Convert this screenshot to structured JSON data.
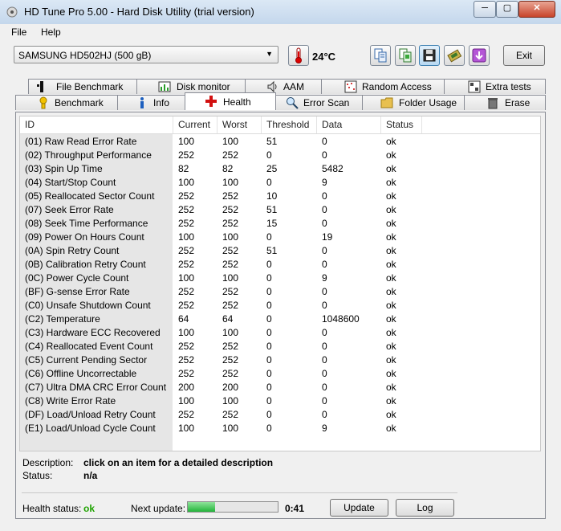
{
  "window": {
    "title": "HD Tune Pro 5.00 - Hard Disk Utility (trial version)",
    "minimize_glyph": "─",
    "maximize_glyph": "▢",
    "close_glyph": "✕"
  },
  "menu": {
    "file": "File",
    "help": "Help"
  },
  "toolbar": {
    "disk": "SAMSUNG HD502HJ (500 gB)",
    "temperature": "24°C",
    "exit_label": "Exit",
    "buttons": [
      "copy-info-icon",
      "copy-screenshot-icon",
      "save-icon",
      "options-icon",
      "download-icon"
    ]
  },
  "tabs": {
    "top": [
      "File Benchmark",
      "Disk monitor",
      "AAM",
      "Random Access",
      "Extra tests"
    ],
    "bottom": [
      "Benchmark",
      "Info",
      "Health",
      "Error Scan",
      "Folder Usage",
      "Erase"
    ],
    "active": "Health"
  },
  "table": {
    "columns": [
      "ID",
      "Current",
      "Worst",
      "Threshold",
      "Data",
      "Status"
    ],
    "rows": [
      [
        "(01) Raw Read Error Rate",
        "100",
        "100",
        "51",
        "0",
        "ok"
      ],
      [
        "(02) Throughput Performance",
        "252",
        "252",
        "0",
        "0",
        "ok"
      ],
      [
        "(03) Spin Up Time",
        "82",
        "82",
        "25",
        "5482",
        "ok"
      ],
      [
        "(04) Start/Stop Count",
        "100",
        "100",
        "0",
        "9",
        "ok"
      ],
      [
        "(05) Reallocated Sector Count",
        "252",
        "252",
        "10",
        "0",
        "ok"
      ],
      [
        "(07) Seek Error Rate",
        "252",
        "252",
        "51",
        "0",
        "ok"
      ],
      [
        "(08) Seek Time Performance",
        "252",
        "252",
        "15",
        "0",
        "ok"
      ],
      [
        "(09) Power On Hours Count",
        "100",
        "100",
        "0",
        "19",
        "ok"
      ],
      [
        "(0A) Spin Retry Count",
        "252",
        "252",
        "51",
        "0",
        "ok"
      ],
      [
        "(0B) Calibration Retry Count",
        "252",
        "252",
        "0",
        "0",
        "ok"
      ],
      [
        "(0C) Power Cycle Count",
        "100",
        "100",
        "0",
        "9",
        "ok"
      ],
      [
        "(BF) G-sense Error Rate",
        "252",
        "252",
        "0",
        "0",
        "ok"
      ],
      [
        "(C0) Unsafe Shutdown Count",
        "252",
        "252",
        "0",
        "0",
        "ok"
      ],
      [
        "(C2) Temperature",
        "64",
        "64",
        "0",
        "1048600",
        "ok"
      ],
      [
        "(C3) Hardware ECC Recovered",
        "100",
        "100",
        "0",
        "0",
        "ok"
      ],
      [
        "(C4) Reallocated Event Count",
        "252",
        "252",
        "0",
        "0",
        "ok"
      ],
      [
        "(C5) Current Pending Sector",
        "252",
        "252",
        "0",
        "0",
        "ok"
      ],
      [
        "(C6) Offline Uncorrectable",
        "252",
        "252",
        "0",
        "0",
        "ok"
      ],
      [
        "(C7) Ultra DMA CRC Error Count",
        "200",
        "200",
        "0",
        "0",
        "ok"
      ],
      [
        "(C8) Write Error Rate",
        "100",
        "100",
        "0",
        "0",
        "ok"
      ],
      [
        "(DF) Load/Unload Retry Count",
        "252",
        "252",
        "0",
        "0",
        "ok"
      ],
      [
        "(E1) Load/Unload Cycle Count",
        "100",
        "100",
        "0",
        "9",
        "ok"
      ]
    ]
  },
  "details": {
    "description_label": "Description:",
    "description_value": "click on an item for a detailed description",
    "status_label": "Status:",
    "status_value": "n/a"
  },
  "footer": {
    "health_label": "Health status:",
    "health_value": "ok",
    "next_update_label": "Next update:",
    "progress_fraction": 0.3,
    "countdown": "0:41",
    "update_label": "Update",
    "log_label": "Log"
  },
  "colors": {
    "health_ok": "#1fa300",
    "progress": "#22b43a",
    "active_tool": "#3c7fb1"
  }
}
